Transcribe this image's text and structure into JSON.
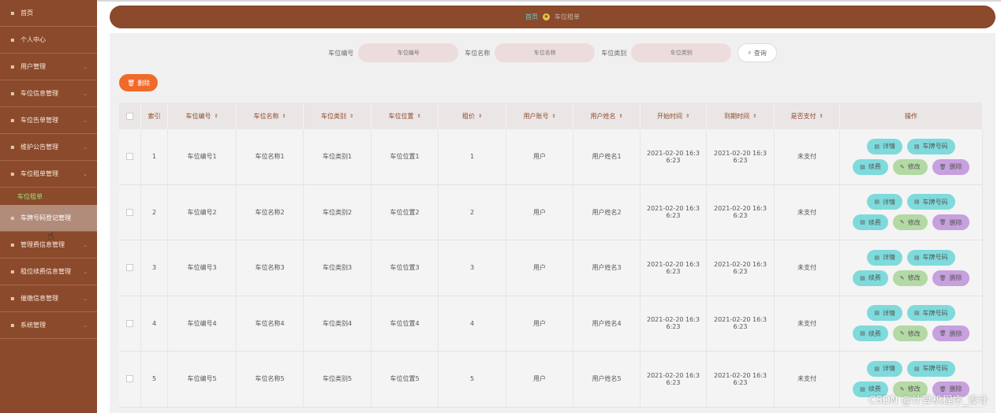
{
  "sidebar": {
    "items": [
      {
        "label": "首页",
        "icon": "home-icon"
      },
      {
        "label": "个人中心",
        "icon": "user-icon"
      },
      {
        "label": "用户管理",
        "icon": "user-manage-icon"
      },
      {
        "label": "车位信息管理",
        "icon": "car-icon"
      },
      {
        "label": "车位告单管理",
        "icon": "phone-icon"
      },
      {
        "label": "维护公告管理",
        "icon": "notice-icon"
      },
      {
        "label": "车位租单管理",
        "icon": "list-icon"
      }
    ],
    "sub_item": "车位租单",
    "items2": [
      {
        "label": "车牌号码登记管理",
        "icon": "plate-icon"
      },
      {
        "label": "管理费信息管理",
        "icon": "fee-icon"
      },
      {
        "label": "租位续费信息管理",
        "icon": "renew-icon"
      },
      {
        "label": "催缴信息管理",
        "icon": "remind-icon"
      },
      {
        "label": "系统管理",
        "icon": "settings-icon"
      }
    ]
  },
  "breadcrumb": {
    "home": "首页",
    "current": "车位租单"
  },
  "search": {
    "fields": [
      {
        "label": "车位编号",
        "placeholder": "车位编号"
      },
      {
        "label": "车位名称",
        "placeholder": "车位名称"
      },
      {
        "label": "车位类别",
        "placeholder": "车位类别"
      }
    ],
    "button": "查询"
  },
  "toolbar": {
    "delete_label": "删除"
  },
  "table": {
    "headers": [
      "索引",
      "车位编号",
      "车位名称",
      "车位类别",
      "车位位置",
      "租价",
      "用户账号",
      "用户姓名",
      "开始时间",
      "到期时间",
      "是否支付",
      "操作"
    ],
    "sort_mark": "⇕",
    "rows": [
      {
        "idx": "1",
        "code": "车位编号1",
        "name": "车位名称1",
        "type": "车位类别1",
        "pos": "车位位置1",
        "price": "1",
        "account": "用户",
        "uname": "用户姓名1",
        "start": "2021-02-20 16:3 6:23",
        "end": "2021-02-20 16:3 6:23",
        "paid": "未支付"
      },
      {
        "idx": "2",
        "code": "车位编号2",
        "name": "车位名称2",
        "type": "车位类别2",
        "pos": "车位位置2",
        "price": "2",
        "account": "用户",
        "uname": "用户姓名2",
        "start": "2021-02-20 16:3 6:23",
        "end": "2021-02-20 16:3 6:23",
        "paid": "未支付"
      },
      {
        "idx": "3",
        "code": "车位编号3",
        "name": "车位名称3",
        "type": "车位类别3",
        "pos": "车位位置3",
        "price": "3",
        "account": "用户",
        "uname": "用户姓名3",
        "start": "2021-02-20 16:3 6:23",
        "end": "2021-02-20 16:3 6:23",
        "paid": "未支付"
      },
      {
        "idx": "4",
        "code": "车位编号4",
        "name": "车位名称4",
        "type": "车位类别4",
        "pos": "车位位置4",
        "price": "4",
        "account": "用户",
        "uname": "用户姓名4",
        "start": "2021-02-20 16:3 6:23",
        "end": "2021-02-20 16:3 6:23",
        "paid": "未支付"
      },
      {
        "idx": "5",
        "code": "车位编号5",
        "name": "车位名称5",
        "type": "车位类别5",
        "pos": "车位位置5",
        "price": "5",
        "account": "用户",
        "uname": "用户姓名5",
        "start": "2021-02-20 16:3 6:23",
        "end": "2021-02-20 16:3 6:23",
        "paid": "未支付"
      }
    ],
    "actions": {
      "detail": "详情",
      "plate": "车牌号码",
      "renew": "续费",
      "edit": "修改",
      "delete": "删除"
    }
  },
  "watermark": "CSDN @计算机程序_设计",
  "colors": {
    "sidebar": "#8a4a2b",
    "accent_delete": "#f06a2a",
    "teal": "#7fdadc",
    "green": "#b3d9a4",
    "purple": "#c7a0de"
  }
}
